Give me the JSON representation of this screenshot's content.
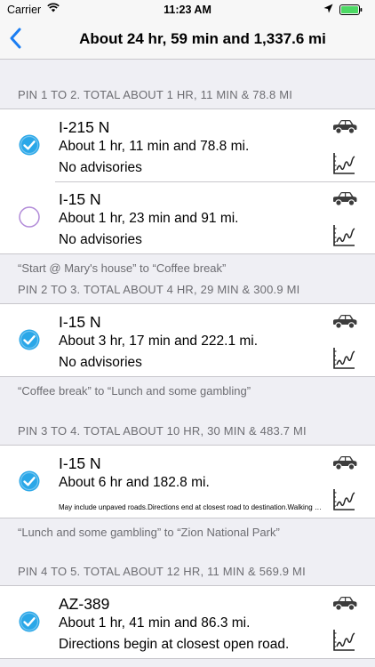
{
  "status_bar": {
    "carrier": "Carrier",
    "time": "11:23 AM"
  },
  "nav": {
    "back_icon": "chevron-left-icon",
    "title": "About 24 hr, 59 min and 1,337.6 mi"
  },
  "colors": {
    "accent": "#1a7df2",
    "check_fill": "#2aa7e8",
    "radio_border": "#b18ad8",
    "battery": "#4cd964"
  },
  "sections": [
    {
      "header": "PIN 1 TO 2. TOTAL ABOUT 1 HR, 11 MIN & 78.8 MI",
      "routes": [
        {
          "road": "I-215 N",
          "summary": "About 1 hr, 11 min and 78.8 mi.",
          "advisory": "No advisories",
          "selected": true
        },
        {
          "road": "I-15 N",
          "summary": "About 1 hr, 23 min and 91 mi.",
          "advisory": "No advisories",
          "selected": false
        }
      ],
      "footer": "“Start @ Mary's house” to “Coffee break”"
    },
    {
      "header": "PIN 2 TO 3. TOTAL ABOUT 4 HR, 29 MIN & 300.9 MI",
      "routes": [
        {
          "road": "I-15 N",
          "summary": "About 3 hr, 17 min and 222.1 mi.",
          "advisory": "No advisories",
          "selected": true
        }
      ],
      "footer": "“Coffee break” to “Lunch and some gambling”"
    },
    {
      "header": "PIN 3 TO 4. TOTAL ABOUT 10 HR, 30 MIN & 483.7 MI",
      "routes": [
        {
          "road": "I-15 N",
          "summary": "About 6 hr and 182.8 mi.",
          "advisory": "May include unpaved roads.Directions end at closest road to destination.Walking directions...",
          "selected": true
        }
      ],
      "footer": "“Lunch and some gambling” to “Zion National Park”"
    },
    {
      "header": "PIN 4 TO 5. TOTAL ABOUT 12 HR, 11 MIN & 569.9 MI",
      "routes": [
        {
          "road": "AZ-389",
          "summary": "About 1 hr, 41 min and 86.3 mi.",
          "advisory": "Directions begin at closest open road.",
          "selected": true
        }
      ]
    }
  ]
}
